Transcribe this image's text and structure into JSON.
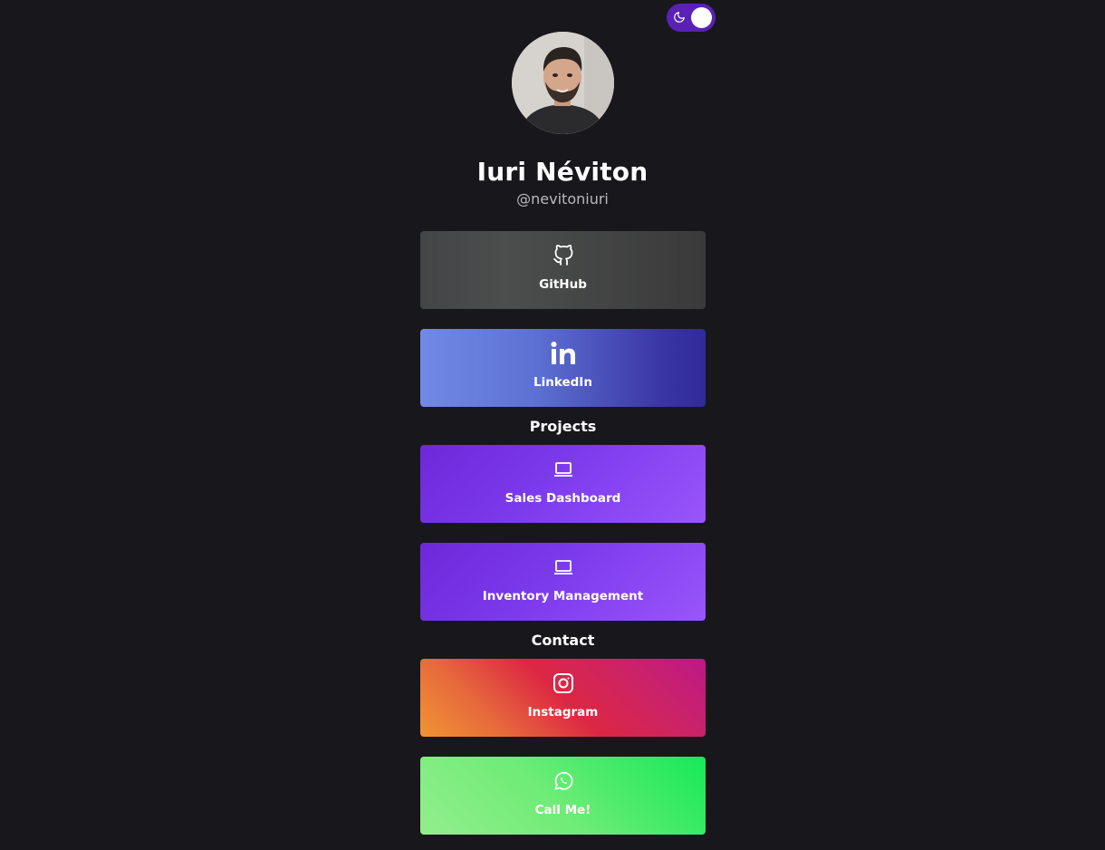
{
  "theme_toggle": {
    "icon": "moon-icon",
    "state": "dark"
  },
  "profile": {
    "name": "Iuri Néviton",
    "handle": "@nevitoniuri"
  },
  "links": [
    {
      "label": "GitHub",
      "icon": "github-icon"
    },
    {
      "label": "LinkedIn",
      "icon": "linkedin-icon"
    }
  ],
  "projects": {
    "title": "Projects",
    "items": [
      {
        "label": "Sales Dashboard",
        "icon": "laptop-icon"
      },
      {
        "label": "Inventory Management",
        "icon": "laptop-icon"
      }
    ]
  },
  "contact": {
    "title": "Contact",
    "items": [
      {
        "label": "Instagram",
        "icon": "instagram-icon"
      },
      {
        "label": "Call Me!",
        "icon": "whatsapp-icon"
      }
    ]
  },
  "colors": {
    "background": "#18171c",
    "toggle": "#5b21b6",
    "github": "#444546",
    "linkedin_start": "#7289e6",
    "linkedin_end": "#302a9a",
    "project_start": "#6d28d9",
    "project_end": "#9a55fa",
    "instagram_start": "#f09433",
    "instagram_end": "#bc1888",
    "whatsapp_start": "#93ee8c",
    "whatsapp_end": "#16e957"
  }
}
